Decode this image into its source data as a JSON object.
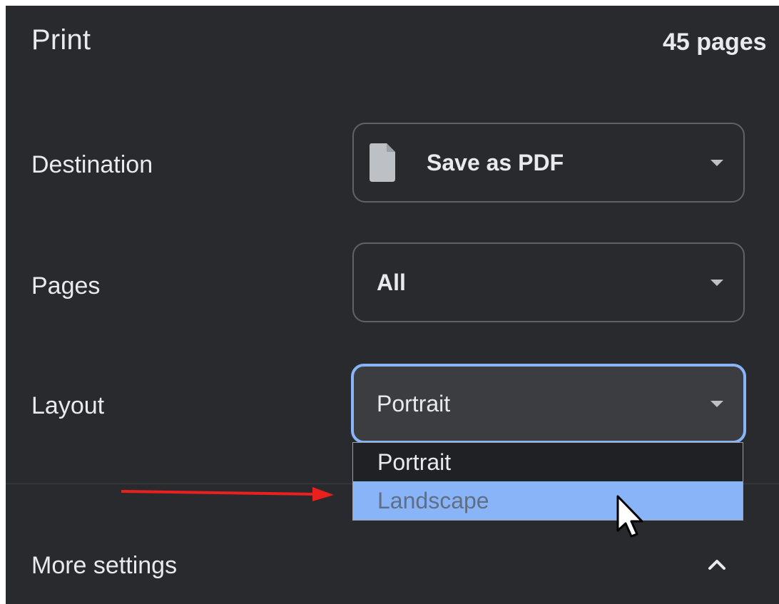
{
  "header": {
    "title": "Print",
    "page_count": "45 pages"
  },
  "destination": {
    "label": "Destination",
    "value": "Save as PDF",
    "icon": "document-icon"
  },
  "pages": {
    "label": "Pages",
    "value": "All"
  },
  "layout": {
    "label": "Layout",
    "value": "Portrait",
    "options": [
      "Portrait",
      "Landscape"
    ],
    "highlighted_option": "Landscape"
  },
  "more_settings": {
    "label": "More settings",
    "icon": "chevron-up-icon"
  },
  "colors": {
    "panel_background": "#292a2d",
    "text": "#e8eaed",
    "focus_border": "#8ab4f8",
    "option_highlight": "#8ab4f8",
    "annotation_arrow": "#e8201e"
  }
}
